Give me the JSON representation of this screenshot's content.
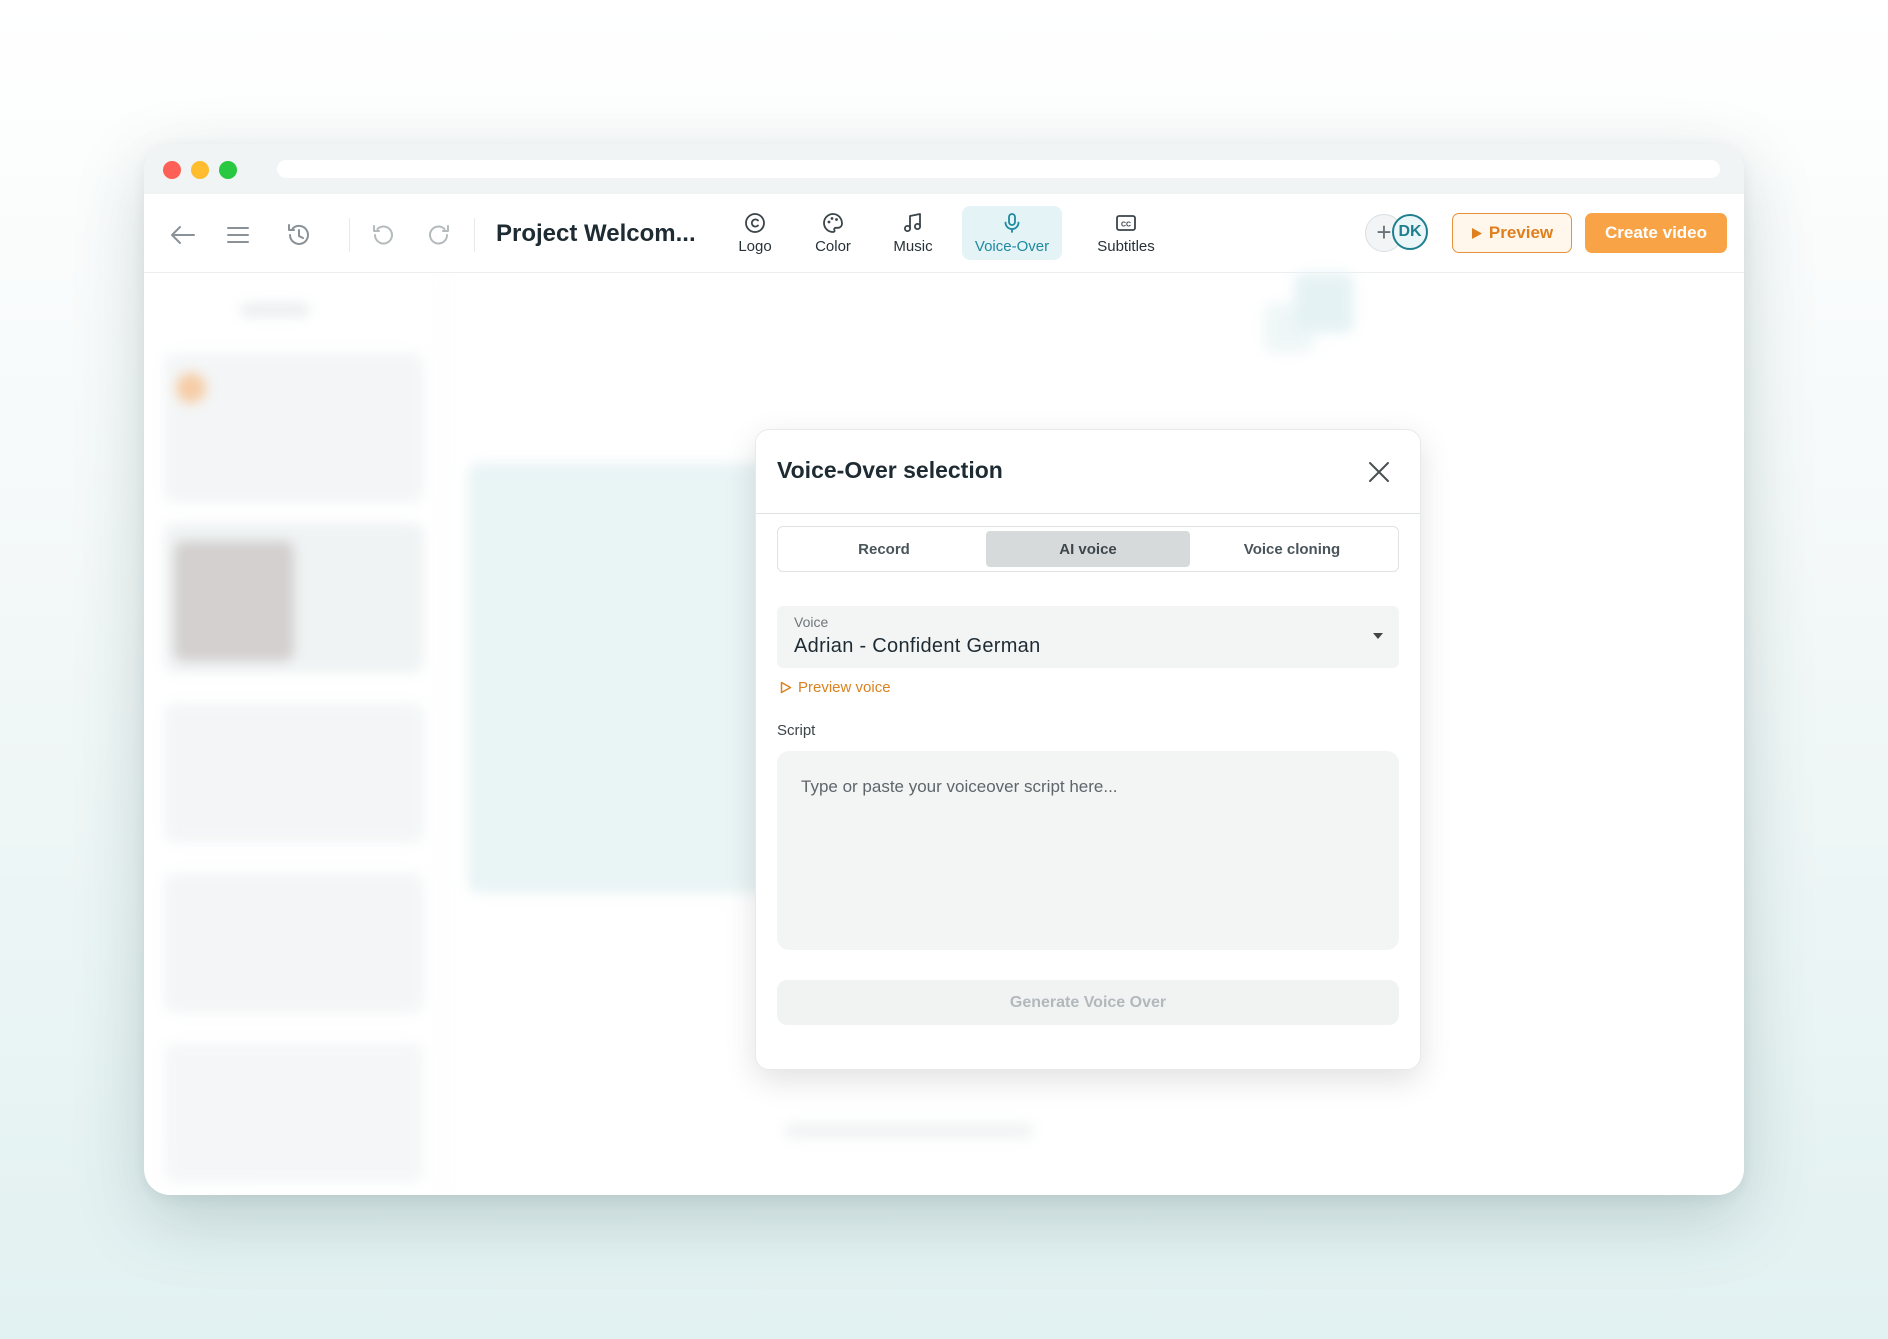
{
  "toolbar": {
    "project_title": "Project Welcom...",
    "tabs": [
      {
        "label": "Logo",
        "icon": "copyright-icon"
      },
      {
        "label": "Color",
        "icon": "palette-icon"
      },
      {
        "label": "Music",
        "icon": "music-note-icon"
      },
      {
        "label": "Voice-Over",
        "icon": "microphone-icon"
      },
      {
        "label": "Subtitles",
        "icon": "closed-captions-icon"
      }
    ],
    "active_tab": "Voice-Over",
    "avatar_initials": "DK",
    "add_collaborator": "+",
    "preview_label": "Preview",
    "create_label": "Create video"
  },
  "modal": {
    "title": "Voice-Over selection",
    "segments": [
      "Record",
      "AI voice",
      "Voice cloning"
    ],
    "active_segment": "AI voice",
    "voice_label": "Voice",
    "voice_value": "Adrian - Confident German",
    "preview_voice_label": "Preview voice",
    "script_label": "Script",
    "script_placeholder": "Type or paste your voiceover script here...",
    "generate_label": "Generate Voice Over"
  },
  "colors": {
    "accent_orange": "#f7a346",
    "accent_teal": "#1f8aa0",
    "title_text": "#1e2b33"
  }
}
